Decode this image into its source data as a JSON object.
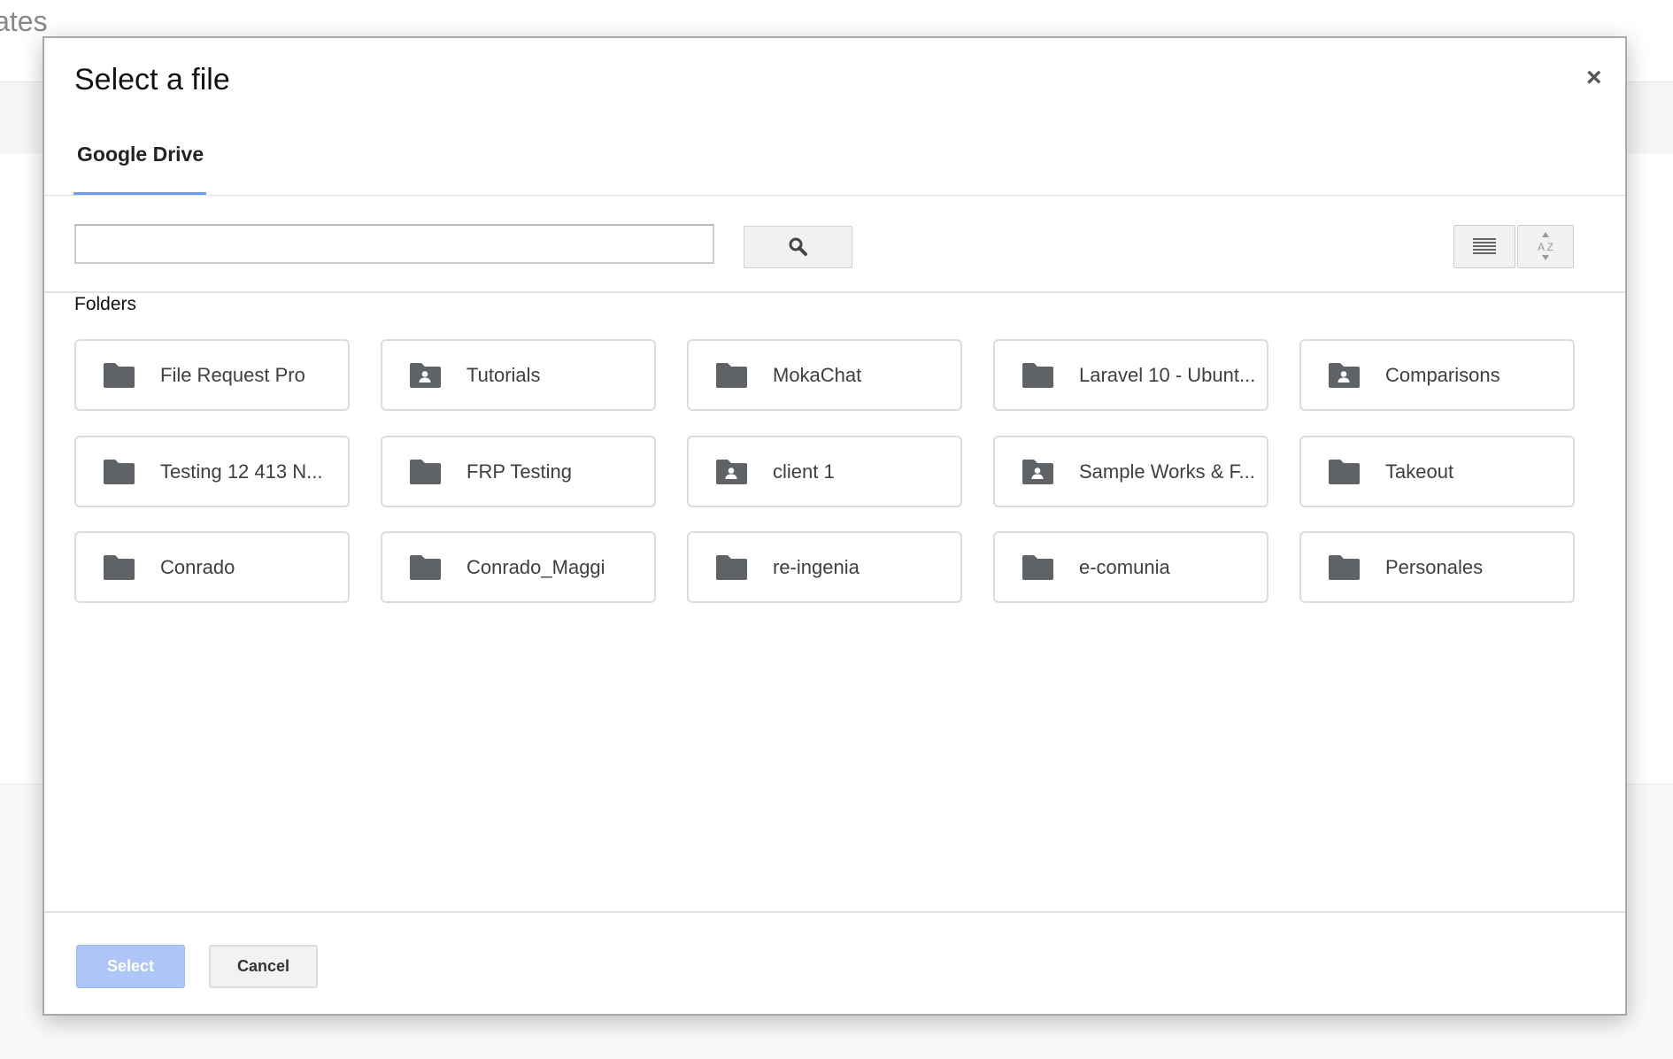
{
  "background": {
    "title_fragment": "lates"
  },
  "dialog": {
    "title": "Select a file",
    "close_label": "×",
    "tabs": [
      {
        "label": "Google Drive",
        "active": true
      }
    ],
    "search": {
      "value": "",
      "placeholder": ""
    },
    "search_icon": "magnifier-icon",
    "view_buttons": [
      {
        "icon": "list-view-icon"
      },
      {
        "icon": "sort-az-icon"
      }
    ],
    "folders_label": "Folders",
    "folders": [
      {
        "name": "File Request Pro",
        "shared": false
      },
      {
        "name": "Tutorials",
        "shared": true
      },
      {
        "name": "MokaChat",
        "shared": false
      },
      {
        "name": "Laravel 10 - Ubunt...",
        "shared": false
      },
      {
        "name": "Comparisons",
        "shared": true
      },
      {
        "name": "Testing 12 413 N...",
        "shared": false
      },
      {
        "name": "FRP Testing",
        "shared": false
      },
      {
        "name": "client 1",
        "shared": true
      },
      {
        "name": "Sample Works & F...",
        "shared": true
      },
      {
        "name": "Takeout",
        "shared": false
      },
      {
        "name": "Conrado",
        "shared": false
      },
      {
        "name": "Conrado_Maggi",
        "shared": false
      },
      {
        "name": "re-ingenia",
        "shared": false
      },
      {
        "name": "e-comunia",
        "shared": false
      },
      {
        "name": "Personales",
        "shared": false
      }
    ],
    "select_label": "Select",
    "cancel_label": "Cancel",
    "colors": {
      "accent": "#6d9eeb",
      "select_disabled": "#aec6f7",
      "folder_icon": "#5f6368"
    }
  }
}
